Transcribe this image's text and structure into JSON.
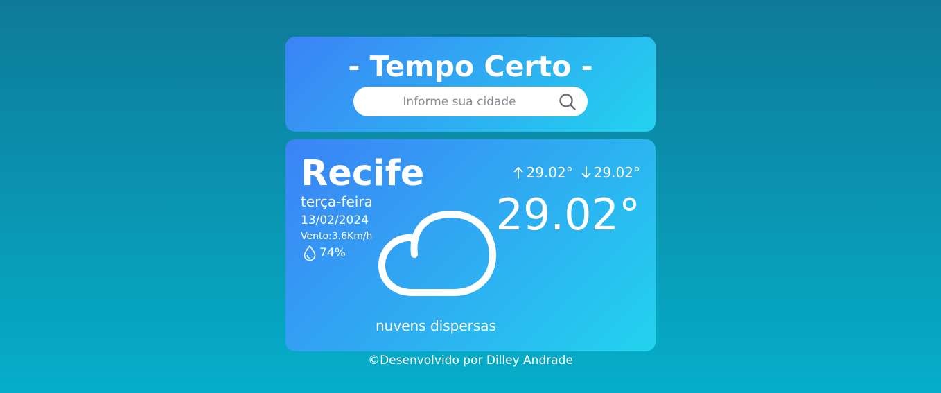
{
  "header": {
    "title": "- Tempo Certo -",
    "search": {
      "placeholder": "Informe sua cidade",
      "value": "",
      "icon": "search-icon"
    }
  },
  "weather": {
    "city": "Recife",
    "weekday": "terça-feira",
    "date": "13/02/2024",
    "wind": "Vento:3.6Km/h",
    "humidity": "74%",
    "humidity_icon": "droplet-icon",
    "max_temp": "29.02°",
    "max_icon": "arrow-up-icon",
    "min_temp": "29.02°",
    "min_icon": "arrow-down-icon",
    "temperature": "29.02°",
    "condition": "nuvens dispersas",
    "condition_icon": "cloud-icon"
  },
  "footer": {
    "credit": "©Desenvolvido por Dilley Andrade"
  },
  "colors": {
    "background_top": "#0e7a97",
    "background_bottom": "#05aecb",
    "card_start": "#3c82f6",
    "card_end": "#22d3ee",
    "text": "#ffffff",
    "placeholder": "#8a8f98"
  }
}
